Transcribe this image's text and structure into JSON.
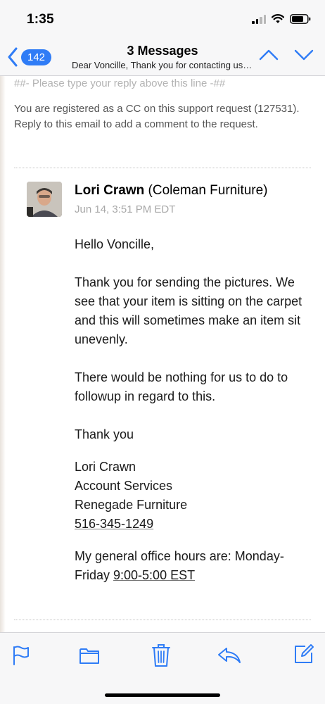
{
  "status_bar": {
    "time": "1:35"
  },
  "nav": {
    "back_count": "142",
    "title": "3 Messages",
    "subtitle": "Dear Voncille, Thank you for contacting us. We're sorry to hear"
  },
  "email": {
    "reply_line": "##- Please type your reply above this line -##",
    "cc_notice": "You are registered as a CC on this support request (127531). Reply to this email to add a comment to the request.",
    "sender_name": "Lori Crawn",
    "sender_company": "(Coleman Furniture)",
    "date": "Jun 14, 3:51 PM EDT",
    "greeting": "Hello Voncille,",
    "paragraph1": "Thank you for sending the pictures. We see that your item is sitting on the carpet and this will sometimes make an item sit unevenly.",
    "paragraph2": "There would be nothing for us to do to followup in regard to this.",
    "closing": "Thank you",
    "signature_name": "Lori Crawn",
    "signature_title": "Account Services",
    "signature_company": "Renegade Furniture",
    "signature_phone": "516-345-1249",
    "hours_text": "My general office hours are: Monday-Friday ",
    "hours_time": "9:00-5:00 EST"
  },
  "toolbar": {
    "icons": [
      "flag-icon",
      "folder-icon",
      "trash-icon",
      "reply-icon",
      "compose-icon"
    ]
  },
  "colors": {
    "accent": "#2f7cf6",
    "toolbar_icon": "#2f7cf6"
  }
}
